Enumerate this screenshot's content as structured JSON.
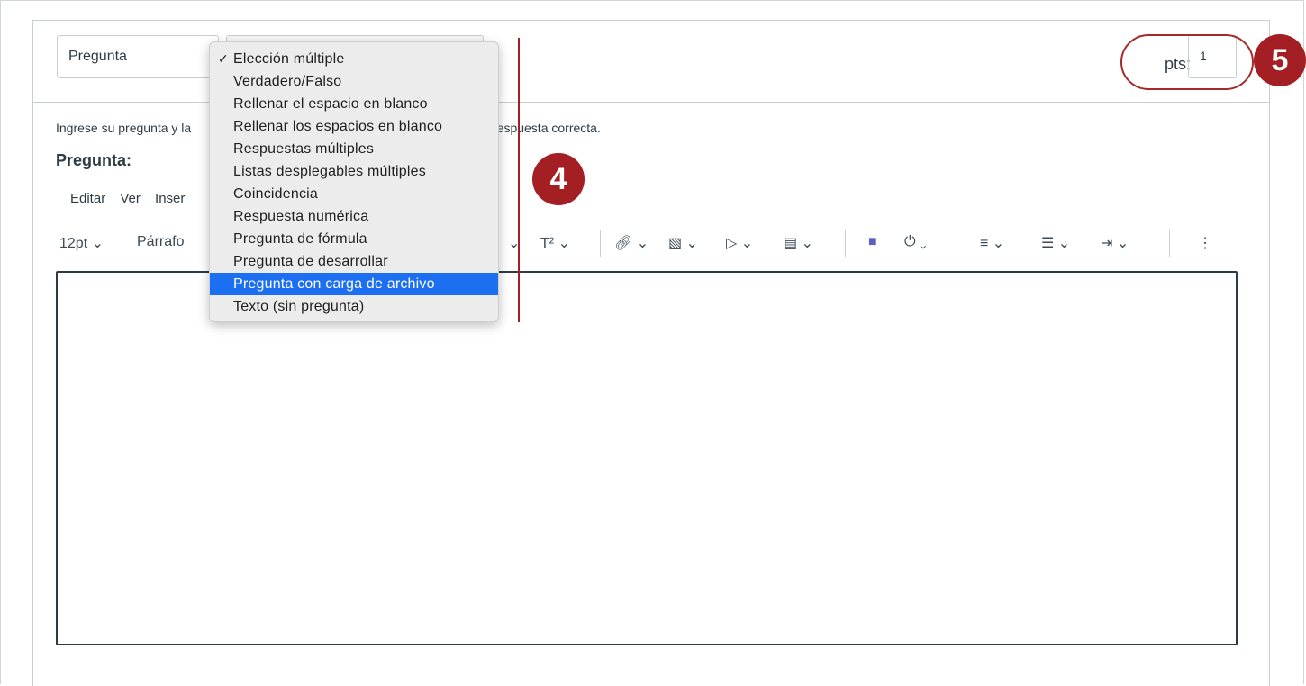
{
  "form": {
    "question_name": "Pregunta",
    "points_label": "pts:",
    "points_value": "1"
  },
  "dropdown": {
    "items": [
      {
        "label": "Elección múltiple",
        "checked": true
      },
      {
        "label": "Verdadero/Falso"
      },
      {
        "label": "Rellenar el espacio en blanco"
      },
      {
        "label": "Rellenar los espacios en blanco"
      },
      {
        "label": "Respuestas múltiples"
      },
      {
        "label": "Listas desplegables múltiples"
      },
      {
        "label": "Coincidencia"
      },
      {
        "label": "Respuesta numérica"
      },
      {
        "label": "Pregunta de fórmula"
      },
      {
        "label": "Pregunta de desarrollar"
      },
      {
        "label": "Pregunta con carga de archivo",
        "highlighted": true
      },
      {
        "label": "Texto (sin pregunta)"
      }
    ],
    "check_mark": "✓"
  },
  "instructions": {
    "left": "Ingrese su pregunta y la",
    "right": "respuesta correcta."
  },
  "question_label": "Pregunta:",
  "menubar": {
    "edit": "Editar",
    "view": "Ver",
    "insert": "Inser"
  },
  "toolbar": {
    "font_size": "12pt",
    "paragraph": "Párrafo",
    "superscript": "T²"
  },
  "badges": {
    "step4": "4",
    "step5": "5"
  },
  "colors": {
    "badge": "#a31f23",
    "highlight": "#1d6ff2"
  }
}
